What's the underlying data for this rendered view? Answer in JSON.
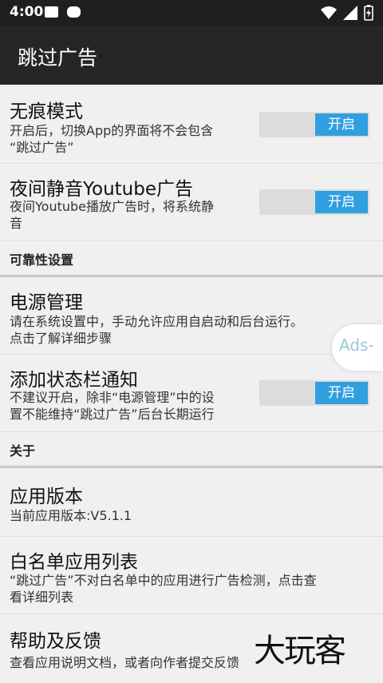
{
  "status_bar": {
    "time": "4:00"
  },
  "app_bar": {
    "title": "跳过广告"
  },
  "items": [
    {
      "title": "无痕模式",
      "desc_lines": [
        "开启后，切换App的界面将不会包含",
        "“跳过广告”"
      ],
      "toggle": "开启"
    },
    {
      "title": "夜间静音Youtube广告",
      "desc_lines": [
        "夜间Youtube播放广告时，将系统静",
        "音"
      ],
      "toggle": "开启"
    }
  ],
  "section_reliability": {
    "title": "可靠性设置"
  },
  "reliability_items": [
    {
      "title": "电源管理",
      "desc_lines": [
        "请在系统设置中，手动允许应用自启动和后台运行。",
        "点击了解详细步骤"
      ]
    },
    {
      "title": "添加状态栏通知",
      "desc_lines": [
        "不建议开启，除非“电源管理”中的设",
        "置不能维持“跳过广告”后台长期运行"
      ],
      "toggle": "开启"
    }
  ],
  "section_about": {
    "title": "关于"
  },
  "about_items": [
    {
      "title": "应用版本",
      "desc_lines": [
        "当前应用版本:V5.1.1"
      ]
    },
    {
      "title": "白名单应用列表",
      "desc_lines": [
        "“跳过广告”不对白名单中的应用进行广告检测，点击查",
        "看详细列表"
      ]
    },
    {
      "title": "帮助及反馈",
      "desc_lines": [
        "查看应用说明文档，或者向作者提交反馈"
      ]
    }
  ],
  "floating_button": {
    "label": "Ads-"
  },
  "watermark": {
    "text": "大玩客"
  }
}
